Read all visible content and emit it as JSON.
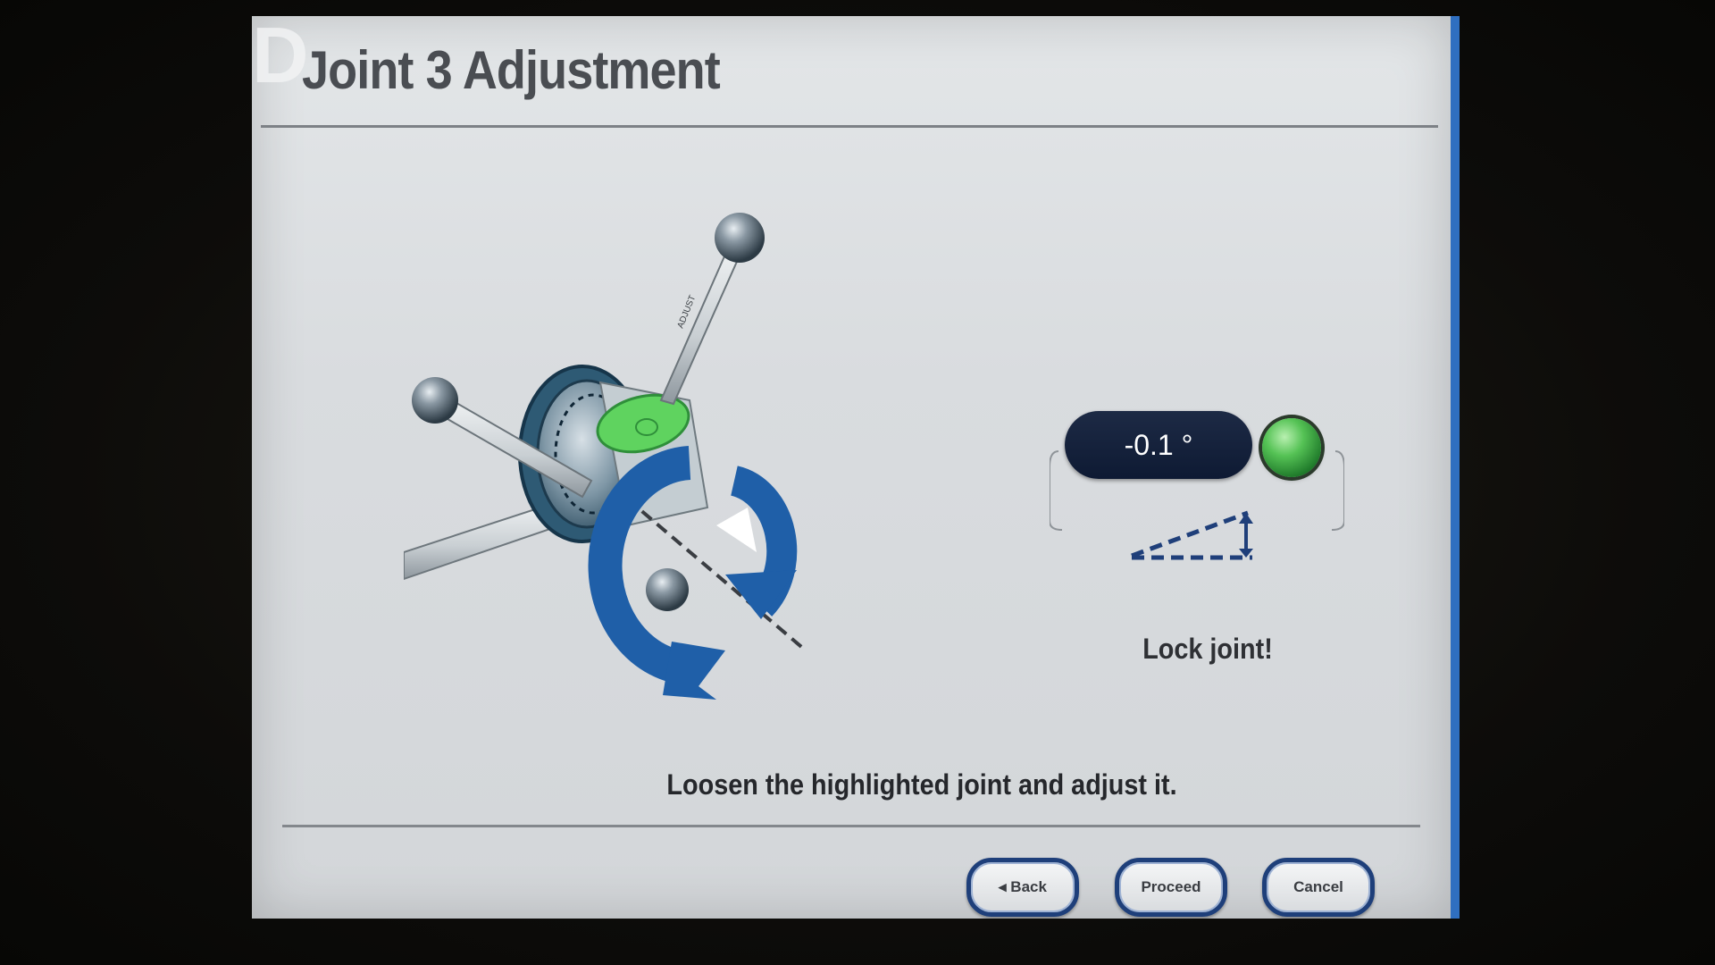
{
  "screen": {
    "logo_letter": "D",
    "title": "Joint 3 Adjustment"
  },
  "readout": {
    "value": "-0.1 °",
    "status_color": "#4fbf4f"
  },
  "messages": {
    "lock": "Lock joint!",
    "instruction": "Loosen the highlighted joint and adjust it."
  },
  "buttons": {
    "back": "◂ Back",
    "proceed": "Proceed",
    "cancel": "Cancel"
  },
  "colors": {
    "accent": "#1e3f7a",
    "arrow": "#1f5fa8",
    "highlight": "#5fd35f"
  },
  "icons": {
    "joint": "joint-assembly-icon",
    "rotate": "rotate-arrows-icon",
    "angle": "angle-tilt-icon"
  }
}
